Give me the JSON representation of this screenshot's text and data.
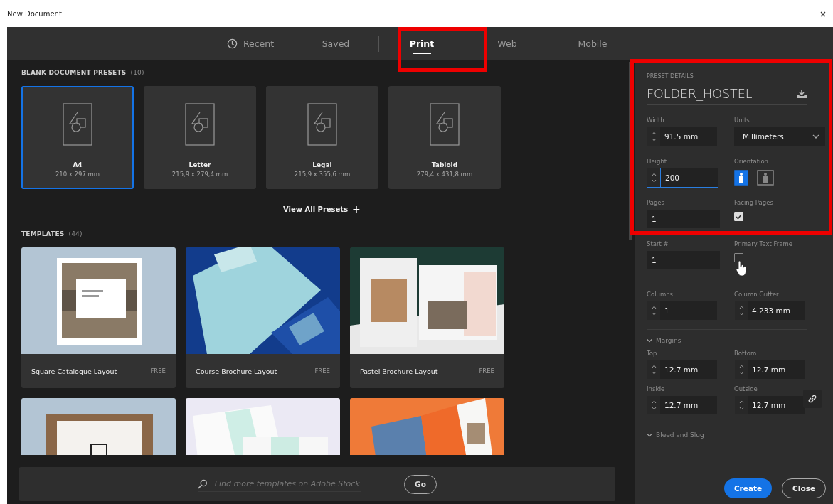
{
  "window": {
    "title": "New Document"
  },
  "tabs": [
    {
      "label": "Recent",
      "selected": false
    },
    {
      "label": "Saved",
      "selected": false
    },
    {
      "label": "Print",
      "selected": true
    },
    {
      "label": "Web",
      "selected": false
    },
    {
      "label": "Mobile",
      "selected": false
    }
  ],
  "presets": {
    "title": "BLANK DOCUMENT PRESETS",
    "count": "(10)",
    "view_all": "View All Presets",
    "view_all_icon": "+",
    "items": [
      {
        "name": "A4",
        "size": "210 x 297 mm",
        "selected": true
      },
      {
        "name": "Letter",
        "size": "215,9 x 279,4 mm",
        "selected": false
      },
      {
        "name": "Legal",
        "size": "215,9 x 355,6 mm",
        "selected": false
      },
      {
        "name": "Tabloid",
        "size": "279,4 x 431,8 mm",
        "selected": false
      }
    ]
  },
  "templates": {
    "title": "TEMPLATES",
    "count": "(44)",
    "items": [
      {
        "name": "Square Catalogue Layout",
        "price": "FREE"
      },
      {
        "name": "Course Brochure Layout",
        "price": "FREE"
      },
      {
        "name": "Pastel Brochure Layout",
        "price": "FREE"
      }
    ]
  },
  "search": {
    "placeholder": "Find more templates on Adobe Stock",
    "button": "Go"
  },
  "details": {
    "title": "PRESET DETAILS",
    "name": "FOLDER_HOSTEL",
    "rows": [
      {
        "kind": "pair",
        "fields": [
          {
            "label": "Width",
            "kind": "stepper",
            "value": "91.5 mm",
            "focused": false
          },
          {
            "label": "Units",
            "kind": "select",
            "value": "Millimeters"
          }
        ]
      },
      {
        "kind": "pair",
        "fields": [
          {
            "label": "Height",
            "kind": "stepper",
            "value": "200",
            "focused": true
          },
          {
            "label": "Orientation",
            "kind": "orientation",
            "options": [
              {
                "selected": true
              },
              {
                "selected": false
              }
            ]
          }
        ]
      },
      {
        "kind": "pair",
        "fields": [
          {
            "label": "Pages",
            "kind": "text",
            "value": "1",
            "focused": false
          },
          {
            "label": "Facing Pages",
            "kind": "checkbox",
            "checked": true
          }
        ]
      },
      {
        "kind": "pair",
        "fields": [
          {
            "label": "Start #",
            "kind": "text",
            "value": "1",
            "focused": false
          },
          {
            "label": "Primary Text Frame",
            "kind": "checkbox",
            "checked": false
          }
        ]
      },
      {
        "kind": "divider"
      },
      {
        "kind": "pair",
        "fields": [
          {
            "label": "Columns",
            "kind": "stepper",
            "value": "1",
            "focused": false
          },
          {
            "label": "Column Gutter",
            "kind": "stepper",
            "value": "4.233 mm",
            "focused": false
          }
        ]
      },
      {
        "kind": "divider"
      },
      {
        "kind": "section",
        "label": "Margins",
        "expanded": true
      },
      {
        "kind": "pair",
        "fields": [
          {
            "label": "Top",
            "kind": "stepper",
            "value": "12.7 mm",
            "focused": false
          },
          {
            "label": "Bottom",
            "kind": "stepper",
            "value": "12.7 mm",
            "focused": false
          }
        ]
      },
      {
        "kind": "pair",
        "link": true,
        "fields": [
          {
            "label": "Inside",
            "kind": "stepper",
            "value": "12.7 mm",
            "focused": false
          },
          {
            "label": "Outside",
            "kind": "stepper",
            "value": "12.7 mm",
            "focused": false
          }
        ]
      },
      {
        "kind": "divider"
      },
      {
        "kind": "section",
        "label": "Bleed and Slug",
        "expanded": true
      }
    ],
    "buttons": [
      {
        "label": "Create",
        "kind": "primary"
      },
      {
        "label": "Close",
        "kind": "secondary"
      }
    ]
  }
}
